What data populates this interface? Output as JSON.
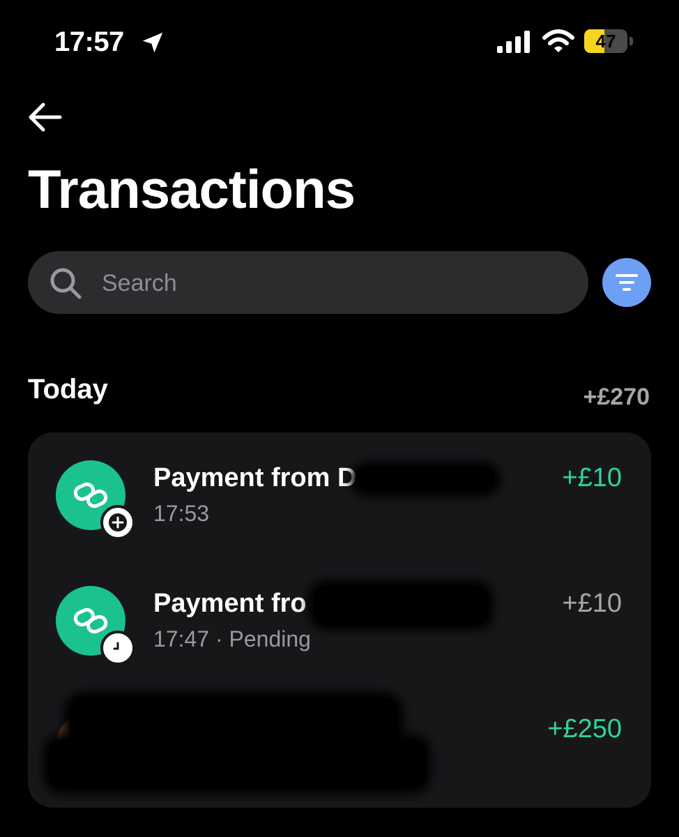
{
  "status_bar": {
    "time": "17:57",
    "battery_level": "47",
    "battery_fraction": 0.47
  },
  "header": {
    "title": "Transactions"
  },
  "search": {
    "placeholder": "Search"
  },
  "section": {
    "title": "Today",
    "total": "+£270"
  },
  "transactions": [
    {
      "title": "Payment from D",
      "subtitle": "17:53",
      "amount": "+£10",
      "icon": "link-icon",
      "badge": "plus-icon",
      "status": "completed"
    },
    {
      "title": "Payment fro",
      "subtitle": "17:47 · Pending",
      "amount": "+£10",
      "icon": "link-icon",
      "badge": "clock-icon",
      "status": "pending"
    },
    {
      "title": "",
      "subtitle": "",
      "amount": "+£250",
      "icon": "avatar-photo",
      "status": "completed"
    }
  ],
  "colors": {
    "accent_green": "#1bc28f",
    "positive_amount": "#2fd39c",
    "filter_blue": "#6da0f5",
    "battery_yellow": "#f7d51d",
    "card_background": "#17171a"
  }
}
